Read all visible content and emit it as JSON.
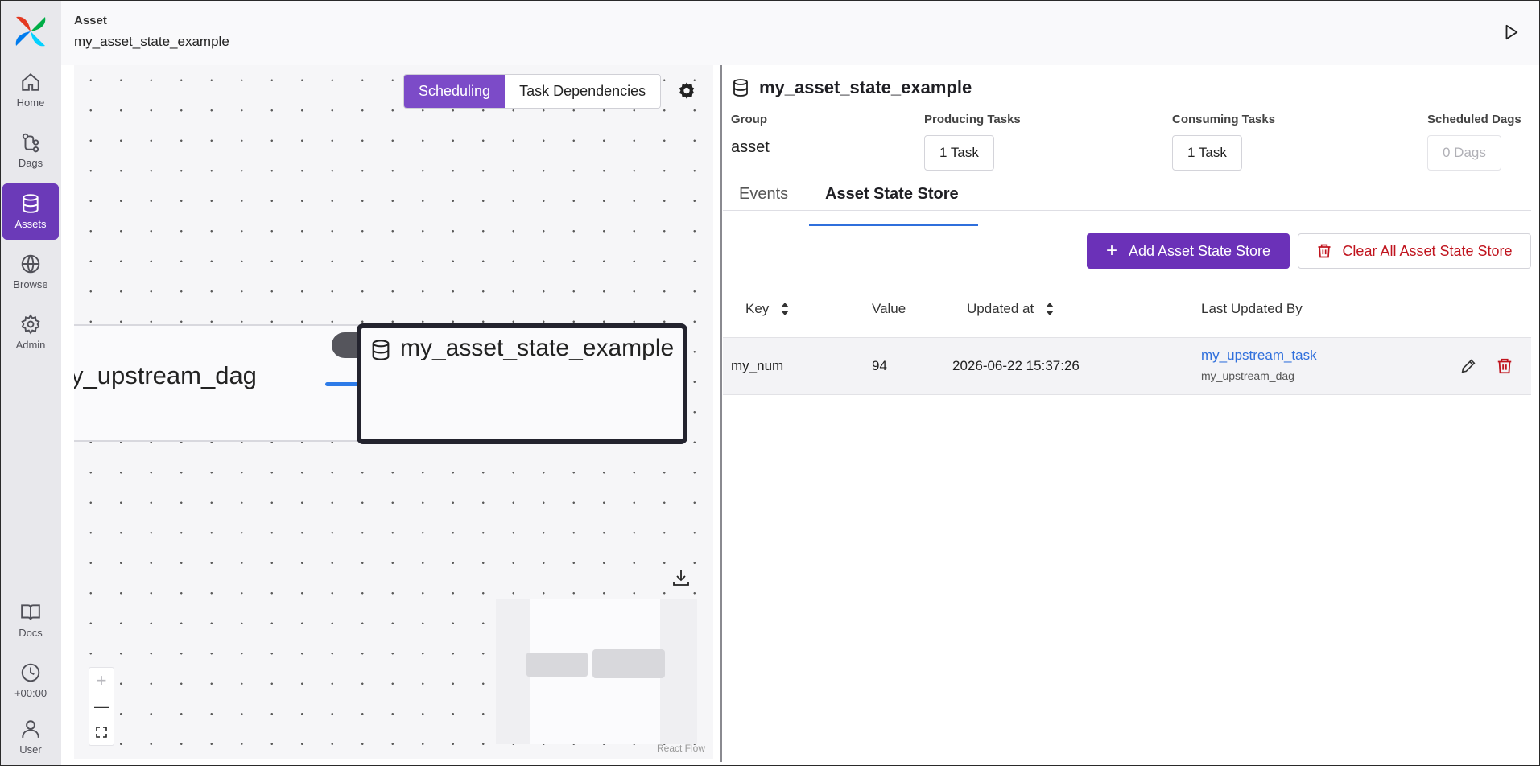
{
  "sidebar": {
    "items": [
      {
        "label": "Home",
        "icon": "home-icon"
      },
      {
        "label": "Dags",
        "icon": "dags-icon"
      },
      {
        "label": "Assets",
        "icon": "database-icon",
        "active": true
      },
      {
        "label": "Browse",
        "icon": "globe-icon"
      },
      {
        "label": "Admin",
        "icon": "gear-icon"
      }
    ],
    "bottom_items": [
      {
        "label": "Docs",
        "icon": "book-icon"
      },
      {
        "label": "+00:00",
        "icon": "clock-icon"
      },
      {
        "label": "User",
        "icon": "user-icon"
      }
    ]
  },
  "header": {
    "label": "Asset",
    "title": "my_asset_state_example"
  },
  "graph": {
    "toggle": {
      "options": [
        "Scheduling",
        "Task Dependencies"
      ],
      "selected": "Scheduling"
    },
    "dag_node_label": "y_upstream_dag",
    "asset_node_label": "my_asset_state_example",
    "watermark": "React Flow",
    "zoom_in": "+",
    "zoom_out": "—"
  },
  "details": {
    "title": "my_asset_state_example",
    "group": {
      "label": "Group",
      "value": "asset"
    },
    "producing": {
      "label": "Producing Tasks",
      "value": "1 Task"
    },
    "consuming": {
      "label": "Consuming Tasks",
      "value": "1 Task"
    },
    "scheduled": {
      "label": "Scheduled Dags",
      "value": "0 Dags"
    },
    "tabs": [
      {
        "label": "Events"
      },
      {
        "label": "Asset State Store",
        "active": true
      }
    ],
    "add_button": "Add Asset State Store",
    "clear_button": "Clear All Asset State Store",
    "table": {
      "columns": [
        "Key",
        "Value",
        "Updated at",
        "Last Updated By"
      ],
      "rows": [
        {
          "key": "my_num",
          "value": "94",
          "updated_at": "2026-06-22 15:37:26",
          "task": "my_upstream_task",
          "dag": "my_upstream_dag"
        }
      ]
    }
  },
  "colors": {
    "accent": "#6b31b8",
    "link": "#2f6fdc",
    "danger": "#c0141e",
    "edge": "#2d7be8"
  }
}
